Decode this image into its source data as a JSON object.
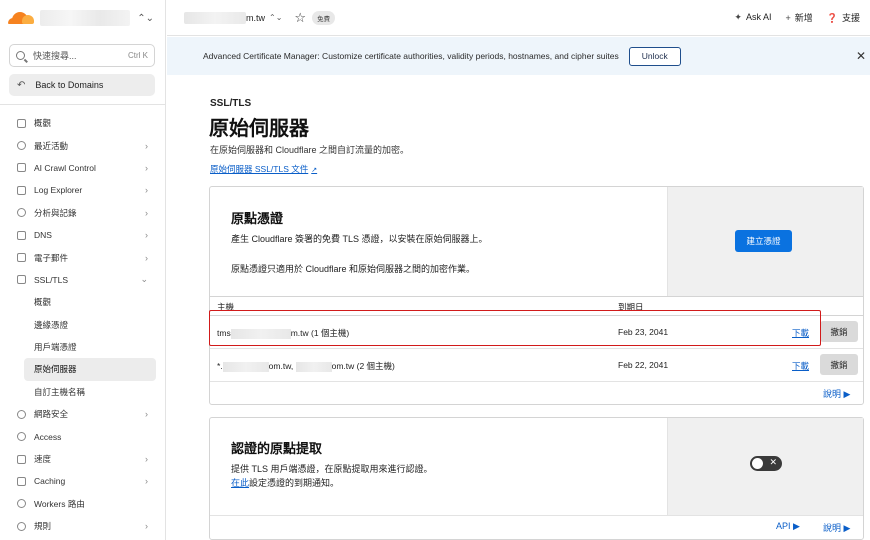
{
  "sidebar": {
    "search_placeholder": "快速搜尋...",
    "search_shortcut": "Ctrl K",
    "back_label": "Back to Domains",
    "items": [
      {
        "label": "概觀"
      },
      {
        "label": "最近活動"
      },
      {
        "label": "AI Crawl Control"
      },
      {
        "label": "Log Explorer"
      },
      {
        "label": "分析與記錄"
      },
      {
        "label": "DNS"
      },
      {
        "label": "電子郵件"
      },
      {
        "label": "SSL/TLS"
      }
    ],
    "subitems": [
      {
        "label": "概觀"
      },
      {
        "label": "邊緣憑證"
      },
      {
        "label": "用戶端憑證"
      },
      {
        "label": "原始伺服器"
      },
      {
        "label": "自訂主機名稱"
      }
    ],
    "items_after": [
      {
        "label": "網路安全"
      },
      {
        "label": "Access"
      },
      {
        "label": "速度"
      },
      {
        "label": "Caching"
      },
      {
        "label": "Workers 路由"
      },
      {
        "label": "規則"
      }
    ]
  },
  "topbar": {
    "domain_suffix": "m.tw",
    "plan_badge": "免費",
    "ask_ai": "Ask AI",
    "new": "新增",
    "support": "支援"
  },
  "banner": {
    "text": "Advanced Certificate Manager: Customize certificate authorities, validity periods, hostnames, and cipher suites",
    "unlock": "Unlock"
  },
  "page": {
    "breadcrumb": "SSL/TLS",
    "title": "原始伺服器",
    "description": "在原始伺服器和 Cloudflare 之間自訂流量的加密。",
    "doc_link": "原始伺服器 SSL/TLS 文件"
  },
  "origin_cert": {
    "title": "原點憑證",
    "desc1": "產生 Cloudflare 簽署的免費 TLS 憑證，以安裝在原始伺服器上。",
    "desc2": "原點憑證只適用於 Cloudflare 和原始伺服器之間的加密作業。",
    "create_button": "建立憑證",
    "col_host": "主機",
    "col_expiry": "到期日",
    "rows": [
      {
        "host_prefix": "tms",
        "host_suffix": "m.tw (1 個主機)",
        "expiry": "Feb 23, 2041",
        "download": "下載",
        "revoke": "撤銷"
      },
      {
        "host_prefix": "*.",
        "host_mid": "om.tw, ",
        "host_suffix": "om.tw (2 個主機)",
        "expiry": "Feb 22, 2041",
        "download": "下載",
        "revoke": "撤銷"
      }
    ],
    "help": "說明"
  },
  "auth_pull": {
    "title": "認證的原點提取",
    "desc1": "提供 TLS 用戶端憑證，在原點提取用來進行認證。",
    "desc2_link": "在此",
    "desc2_rest": "設定憑證的到期通知。",
    "api": "API",
    "help": "說明"
  }
}
